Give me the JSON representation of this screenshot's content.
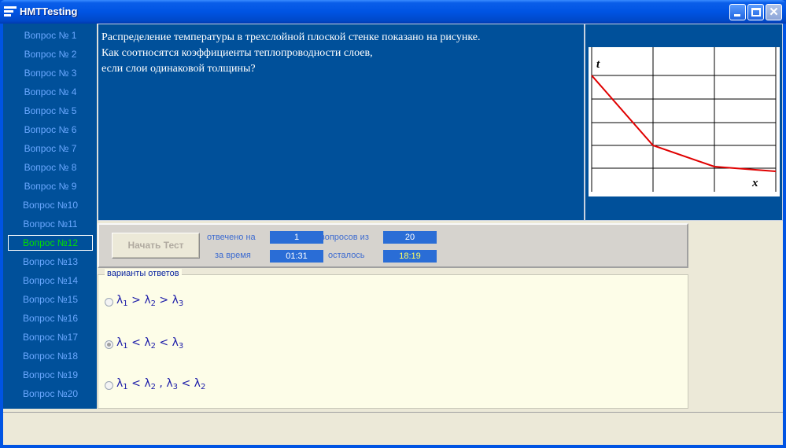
{
  "window": {
    "title": "HMTTesting"
  },
  "sidebar": {
    "items": [
      {
        "label": "Вопрос № 1"
      },
      {
        "label": "Вопрос № 2"
      },
      {
        "label": "Вопрос № 3"
      },
      {
        "label": "Вопрос № 4"
      },
      {
        "label": "Вопрос № 5"
      },
      {
        "label": "Вопрос № 6"
      },
      {
        "label": "Вопрос № 7"
      },
      {
        "label": "Вопрос № 8"
      },
      {
        "label": "Вопрос № 9"
      },
      {
        "label": "Вопрос №10"
      },
      {
        "label": "Вопрос №11"
      },
      {
        "label": "Вопрос №12"
      },
      {
        "label": "Вопрос №13"
      },
      {
        "label": "Вопрос №14"
      },
      {
        "label": "Вопрос №15"
      },
      {
        "label": "Вопрос №16"
      },
      {
        "label": "Вопрос №17"
      },
      {
        "label": "Вопрос №18"
      },
      {
        "label": "Вопрос №19"
      },
      {
        "label": "Вопрос №20"
      }
    ],
    "active_index": 11
  },
  "question": {
    "lines": [
      "Распределение температуры в трехслойной плоской стенке показано на рисунке.",
      "Как соотносятся коэффициенты теплопроводности слоев,",
      "если слои одинаковой толщины?"
    ]
  },
  "figure": {
    "y_label": "t",
    "x_label": "x",
    "line_color": "#e00000"
  },
  "controls": {
    "start_button": "Начать Тест",
    "answered_label": "отвечено на",
    "answered_value": "1",
    "questions_of_label": "вопросов из",
    "questions_total": "20",
    "time_label": "за время",
    "time_value": "01:31",
    "remaining_label": "осталось",
    "remaining_value": "18:19"
  },
  "answers": {
    "group_title": "варианты ответов",
    "options": [
      {
        "parts": [
          [
            "λ",
            "1"
          ],
          " > ",
          [
            "λ",
            "2"
          ],
          " > ",
          [
            "λ",
            "3"
          ]
        ],
        "checked": false
      },
      {
        "parts": [
          [
            "λ",
            "1"
          ],
          " < ",
          [
            "λ",
            "2"
          ],
          " < ",
          [
            "λ",
            "3"
          ]
        ],
        "checked": true
      },
      {
        "parts": [
          [
            "λ",
            "1"
          ],
          " < ",
          [
            "λ",
            "2"
          ],
          " , ",
          [
            "λ",
            "3"
          ],
          " < ",
          [
            "λ",
            "2"
          ]
        ],
        "checked": false
      }
    ]
  },
  "colors": {
    "panel_blue": "#00509a",
    "sidebar_text": "#6aa8ff",
    "active_item": "#00e000"
  }
}
